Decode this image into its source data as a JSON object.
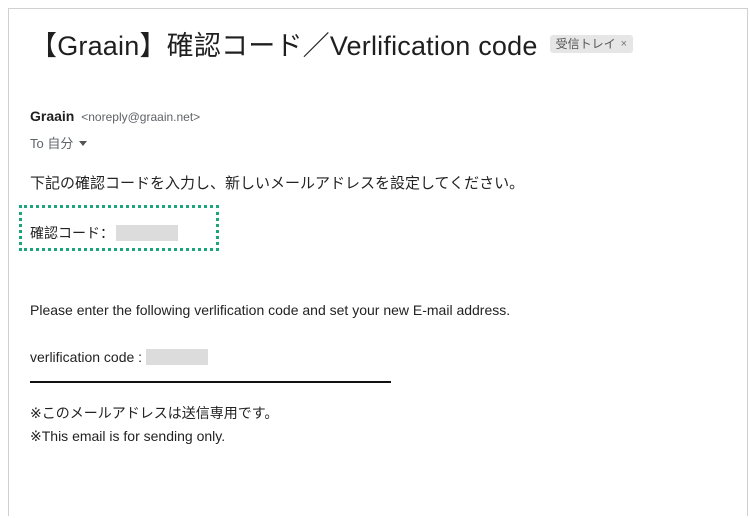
{
  "email": {
    "subject": "【Graain】確認コード／Verlification code",
    "label": "受信トレイ",
    "label_close": "×",
    "sender_name": "Graain",
    "sender_email": "<noreply@graain.net>",
    "to_text": "To 自分",
    "body": {
      "jp_instruction": "下記の確認コードを入力し、新しいメールアドレスを設定してください。",
      "jp_code_label": "確認コード：",
      "en_instruction": "Please enter the following verlification code and set your new E-mail address.",
      "en_code_label": "verlification code :",
      "note_jp": "※このメールアドレスは送信専用です。",
      "note_en": "※This email is for sending only."
    }
  },
  "icons": {
    "recipient_dropdown": "chevron-down-icon",
    "label_remove": "close-icon"
  },
  "colors": {
    "highlight_border": "#1aa57a",
    "redaction": "#dcdcdc",
    "label_chip_bg": "#e6e6e6"
  }
}
